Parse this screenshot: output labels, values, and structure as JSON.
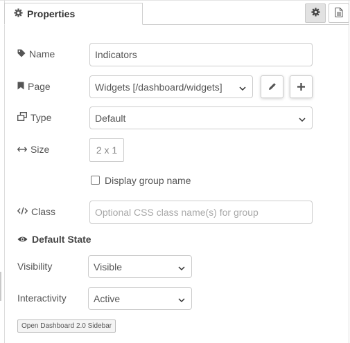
{
  "tabs": {
    "properties_label": "Properties"
  },
  "form": {
    "name": {
      "label": "Name",
      "value": "Indicators"
    },
    "page": {
      "label": "Page",
      "selected": "Widgets [/dashboard/widgets]"
    },
    "type": {
      "label": "Type",
      "selected": "Default"
    },
    "size": {
      "label": "Size",
      "value": "2 x 1"
    },
    "display_group_name": {
      "label": "Display group name",
      "checked": false
    },
    "class": {
      "label": "Class",
      "placeholder": "Optional CSS class name(s) for group"
    }
  },
  "default_state": {
    "title": "Default State",
    "visibility": {
      "label": "Visibility",
      "selected": "Visible"
    },
    "interactivity": {
      "label": "Interactivity",
      "selected": "Active"
    }
  },
  "footer": {
    "sidebar_button": "Open Dashboard 2.0 Sidebar"
  },
  "icons": {
    "properties_tab": "gear-icon",
    "tool_settings": "gear-icon",
    "tool_info": "document-icon",
    "name": "tag-icon",
    "page": "bookmark-icon",
    "type": "window-restore-icon",
    "size": "arrows-horizontal-icon",
    "class": "code-icon",
    "default_state": "eye-icon",
    "edit": "pencil-icon",
    "add": "plus-icon",
    "dropdown": "chevron-down-icon"
  }
}
